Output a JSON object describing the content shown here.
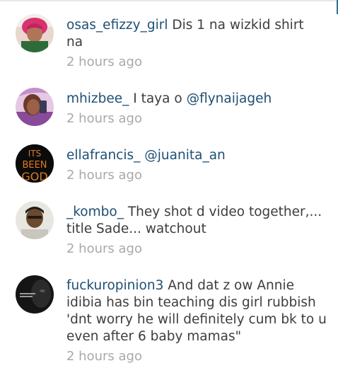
{
  "comments": [
    {
      "username": "osas_efizzy_girl",
      "text_lines": [
        "Dis 1 na wizkid shirt",
        "na"
      ],
      "time": "2 hours ago",
      "avatar": "person-pink-hair-photo"
    },
    {
      "username": "mhizbee_",
      "text_before": "I taya o",
      "mention": "@flynaijageh",
      "time": "2 hours ago",
      "avatar": "person-selfie-photo"
    },
    {
      "username": "ellafrancis_",
      "mention": "@juanita_an",
      "time": "2 hours ago",
      "avatar_text": [
        "ITS",
        "BEEN",
        "GOD"
      ]
    },
    {
      "username": "_kombo_",
      "text_lines": [
        "They shot d video together,...",
        "title Sade... watchout"
      ],
      "time": "2 hours ago",
      "avatar": "person-portrait-photo"
    },
    {
      "username": "fuckuropinion3",
      "text_lines": [
        "And dat z ow Annie",
        "idibia has bin teaching dis girl rubbish",
        "'dnt worry he will definitely cum bk to u",
        "even after 6 baby mamas\""
      ],
      "time": "2 hours ago",
      "avatar": "dark-face-photo"
    }
  ],
  "colors": {
    "username": "#1e4f75",
    "text": "#3d3d3d",
    "timestamp": "#a9a9a9"
  }
}
